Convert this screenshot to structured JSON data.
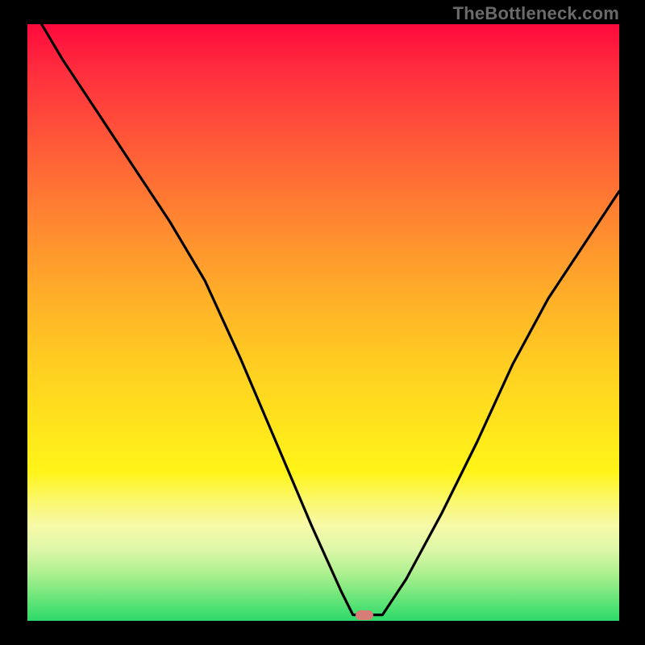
{
  "watermark": "TheBottleneck.com",
  "colors": {
    "curve": "#000000",
    "marker": "#d87c78",
    "axes_bg": "#000000"
  },
  "chart_data": {
    "type": "line",
    "title": "",
    "xlabel": "",
    "ylabel": "",
    "xlim": [
      0,
      100
    ],
    "ylim": [
      0,
      100
    ],
    "grid": false,
    "legend": false,
    "background": "vertical-gradient-red-to-green",
    "series": [
      {
        "name": "bottleneck-curve",
        "x": [
          0,
          6,
          12,
          18,
          24,
          30,
          36,
          42,
          48,
          53,
          55,
          57,
          60,
          64,
          70,
          76,
          82,
          88,
          94,
          100
        ],
        "values": [
          104,
          94,
          85,
          76,
          67,
          57,
          44,
          30,
          16,
          5,
          1,
          1,
          1,
          7,
          18,
          30,
          43,
          54,
          63,
          72
        ]
      }
    ],
    "min_point": {
      "x": 57,
      "y": 1
    },
    "annotations": [
      {
        "type": "marker",
        "shape": "rounded-rect",
        "x": 57,
        "y": 1,
        "color": "#d87c78"
      }
    ]
  }
}
